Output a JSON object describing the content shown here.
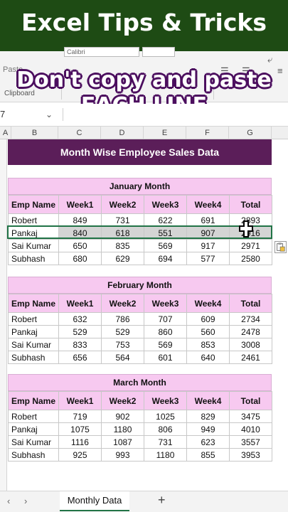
{
  "banner": {
    "title": "Excel Tips & Tricks"
  },
  "overlay": {
    "line1": "Don't copy and paste",
    "line2": "EACH LINE"
  },
  "ribbon": {
    "font_name": "Calibri",
    "paste_label": "Paste",
    "clipboard_label": "Clipboard"
  },
  "formula_bar": {
    "name_box": "7"
  },
  "column_headers": [
    "A",
    "B",
    "C",
    "D",
    "E",
    "F",
    "G"
  ],
  "sheet": {
    "title": "Month Wise Employee Sales Data",
    "headers": [
      "Emp Name",
      "Week1",
      "Week2",
      "Week3",
      "Week4",
      "Total"
    ],
    "months": [
      {
        "title": "January Month",
        "rows": [
          [
            "Robert",
            "849",
            "731",
            "622",
            "691",
            "2893"
          ],
          [
            "Pankaj",
            "840",
            "618",
            "551",
            "907",
            "2916"
          ],
          [
            "Sai Kumar",
            "650",
            "835",
            "569",
            "917",
            "2971"
          ],
          [
            "Subhash",
            "680",
            "629",
            "694",
            "577",
            "2580"
          ]
        ]
      },
      {
        "title": "February Month",
        "rows": [
          [
            "Robert",
            "632",
            "786",
            "707",
            "609",
            "2734"
          ],
          [
            "Pankaj",
            "529",
            "529",
            "860",
            "560",
            "2478"
          ],
          [
            "Sai Kumar",
            "833",
            "753",
            "569",
            "853",
            "3008"
          ],
          [
            "Subhash",
            "656",
            "564",
            "601",
            "640",
            "2461"
          ]
        ]
      },
      {
        "title": "March Month",
        "rows": [
          [
            "Robert",
            "719",
            "902",
            "1025",
            "829",
            "3475"
          ],
          [
            "Pankaj",
            "1075",
            "1180",
            "806",
            "949",
            "4010"
          ],
          [
            "Sai Kumar",
            "1116",
            "1087",
            "731",
            "623",
            "3557"
          ],
          [
            "Subhash",
            "925",
            "993",
            "1180",
            "855",
            "3953"
          ]
        ]
      }
    ]
  },
  "tabs": {
    "active": "Monthly Data",
    "add": "+",
    "prev": "‹",
    "next": "›"
  },
  "colors": {
    "banner": "#1e4b14",
    "title_fill": "#5b1e59",
    "header_fill": "#f7c9f0",
    "overlay_outline": "#4c0f5f",
    "selection": "#217346"
  }
}
